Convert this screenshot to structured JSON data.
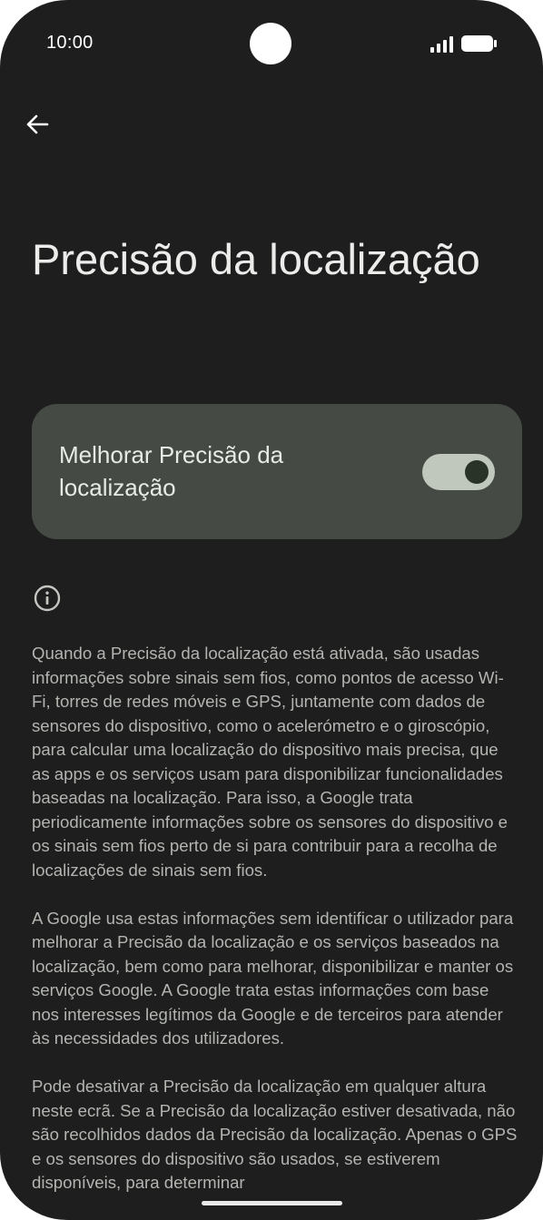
{
  "status_bar": {
    "time": "10:00"
  },
  "header": {
    "back_icon": "arrow-left-icon",
    "title": "Precisão da localização"
  },
  "setting": {
    "label": "Melhorar Precisão da localização",
    "enabled": true
  },
  "info": {
    "icon": "info-icon",
    "paragraphs": [
      "Quando a Precisão da localização está ativada, são usadas informações sobre sinais sem fios, como pontos de acesso Wi-Fi, torres de redes móveis e GPS, juntamente com dados de sensores do dispositivo, como o acelerómetro e o giroscópio, para calcular uma localização do dispositivo mais precisa, que as apps e os serviços usam para disponibilizar funcionalidades baseadas na localização. Para isso, a Google trata periodicamente informações sobre os sensores do dispositivo e os sinais sem fios perto de si para contribuir para a recolha de localizações de sinais sem fios.",
      "A Google usa estas informações sem identificar o utilizador para melhorar a Precisão da localização e os serviços baseados na localização, bem como para melhorar, disponibilizar e manter os serviços Google. A Google trata estas informações com base nos interesses legítimos da Google e de terceiros para atender às necessidades dos utilizadores.",
      "Pode desativar a Precisão da localização em qualquer altura neste ecrã. Se a Precisão da localização estiver desativada, não são recolhidos dados da Precisão da localização. Apenas o GPS e os sensores do dispositivo são usados, se estiverem disponíveis, para determinar"
    ]
  },
  "colors": {
    "background": "#1d1e1d",
    "card": "#454b44",
    "switch_track": "#c0c8bd",
    "switch_thumb": "#2a3327"
  }
}
